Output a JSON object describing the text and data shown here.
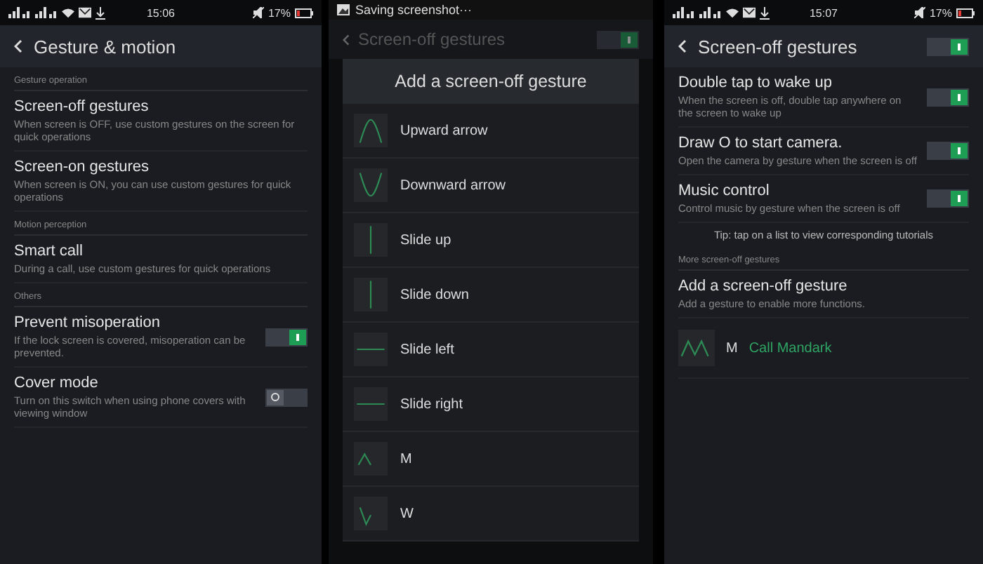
{
  "settings_screen": {
    "status_bar": {
      "time": "15:06",
      "battery": "17%"
    },
    "title": "Gesture & motion",
    "sections": [
      {
        "header": "Gesture operation",
        "items": [
          {
            "kind": "text",
            "title": "Screen-off gestures",
            "subtitle": "When screen is OFF, use custom gestures on the screen for quick operations"
          },
          {
            "kind": "text",
            "title": "Screen-on gestures",
            "subtitle": "When screen is ON, you can use custom gestures for quick operations"
          }
        ]
      },
      {
        "header": "Motion perception",
        "items": [
          {
            "kind": "text",
            "title": "Smart call",
            "subtitle": "During a call, use custom gestures for quick operations"
          }
        ]
      },
      {
        "header": "Others",
        "items": [
          {
            "kind": "switch",
            "title": "Prevent misoperation",
            "subtitle": "If the lock screen is covered, misoperation can be prevented.",
            "on": true
          },
          {
            "kind": "switch",
            "title": "Cover mode",
            "subtitle": "Turn on this switch when using phone covers with viewing window",
            "on": false
          }
        ]
      }
    ]
  },
  "dialog_screen": {
    "notification": "Saving screenshot···",
    "title": "Screen-off gestures",
    "on": true,
    "dialog": {
      "title": "Add a screen-off gesture",
      "gestures": [
        {
          "kind": "up",
          "label": "Upward arrow"
        },
        {
          "kind": "down",
          "label": "Downward arrow"
        },
        {
          "kind": "vertical",
          "label": "Slide up"
        },
        {
          "kind": "vertical",
          "label": "Slide down"
        },
        {
          "kind": "horizontal",
          "label": "Slide left"
        },
        {
          "kind": "horizontal",
          "label": "Slide right"
        },
        {
          "kind": "m",
          "label": "M"
        },
        {
          "kind": "w",
          "label": "W"
        }
      ]
    }
  },
  "gestures_screen": {
    "status_bar": {
      "time": "15:07",
      "battery": "17%"
    },
    "title": "Screen-off gestures",
    "on": true,
    "items": [
      {
        "title": "Double tap to wake up",
        "subtitle": "When the screen is off, double tap anywhere on the screen to wake up",
        "on": true
      },
      {
        "title": "Draw O to start camera.",
        "subtitle": "Open the camera by gesture when the screen is off",
        "on": true
      },
      {
        "title": "Music control",
        "subtitle": "Control music by gesture when the screen is off",
        "on": true
      }
    ],
    "tip": "Tip: tap on a list to view corresponding tutorials",
    "section_header": "More screen-off gestures",
    "add": {
      "title": "Add a screen-off gesture",
      "subtitle": "Add a gesture to enable more functions."
    },
    "custom": [
      {
        "kind": "mm",
        "letter": "M",
        "action": "Call Mandark"
      }
    ]
  }
}
